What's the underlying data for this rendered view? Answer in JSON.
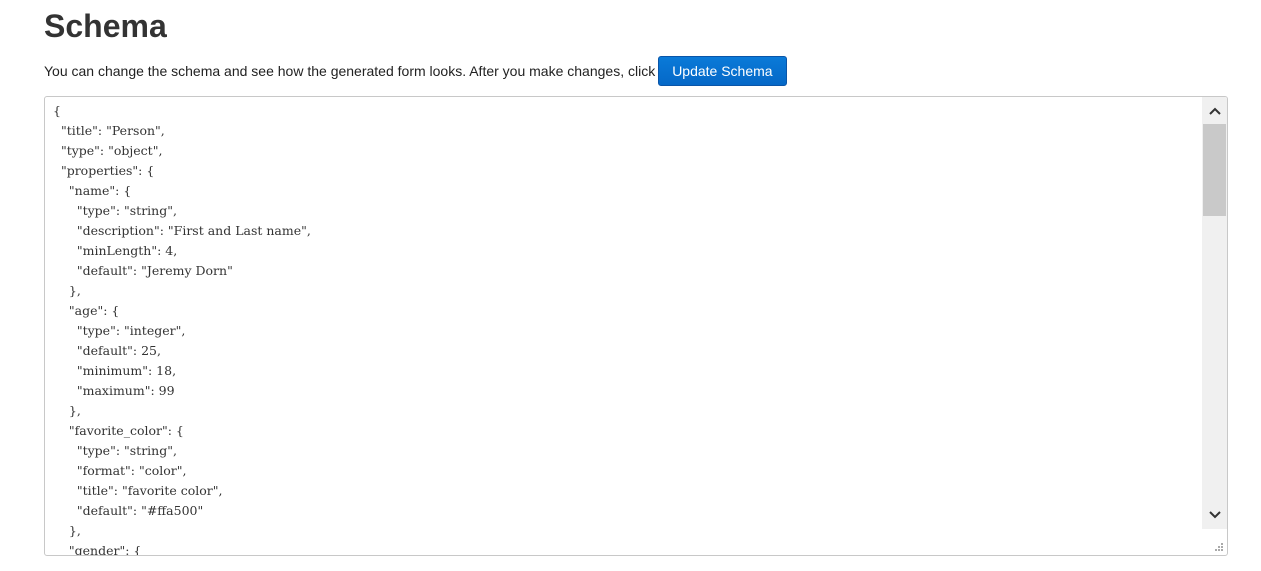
{
  "heading": "Schema",
  "intro_text": "You can change the schema and see how the generated form looks. After you make changes, click",
  "update_button": "Update Schema",
  "icons": {
    "scroll_up": "chevron-up-icon",
    "scroll_down": "chevron-down-icon",
    "resize": "resize-grip-icon"
  },
  "colors": {
    "button_bg": "#0568c7",
    "button_text": "#ffffff",
    "heading_text": "#333333"
  },
  "schema_lines": [
    "{",
    "  \"title\": \"Person\",",
    "  \"type\": \"object\",",
    "  \"properties\": {",
    "    \"name\": {",
    "      \"type\": \"string\",",
    "      \"description\": \"First and Last name\",",
    "      \"minLength\": 4,",
    "      \"default\": \"Jeremy Dorn\"",
    "    },",
    "    \"age\": {",
    "      \"type\": \"integer\",",
    "      \"default\": 25,",
    "      \"minimum\": 18,",
    "      \"maximum\": 99",
    "    },",
    "    \"favorite_color\": {",
    "      \"type\": \"string\",",
    "      \"format\": \"color\",",
    "      \"title\": \"favorite color\",",
    "      \"default\": \"#ffa500\"",
    "    },",
    "    \"gender\": {"
  ]
}
